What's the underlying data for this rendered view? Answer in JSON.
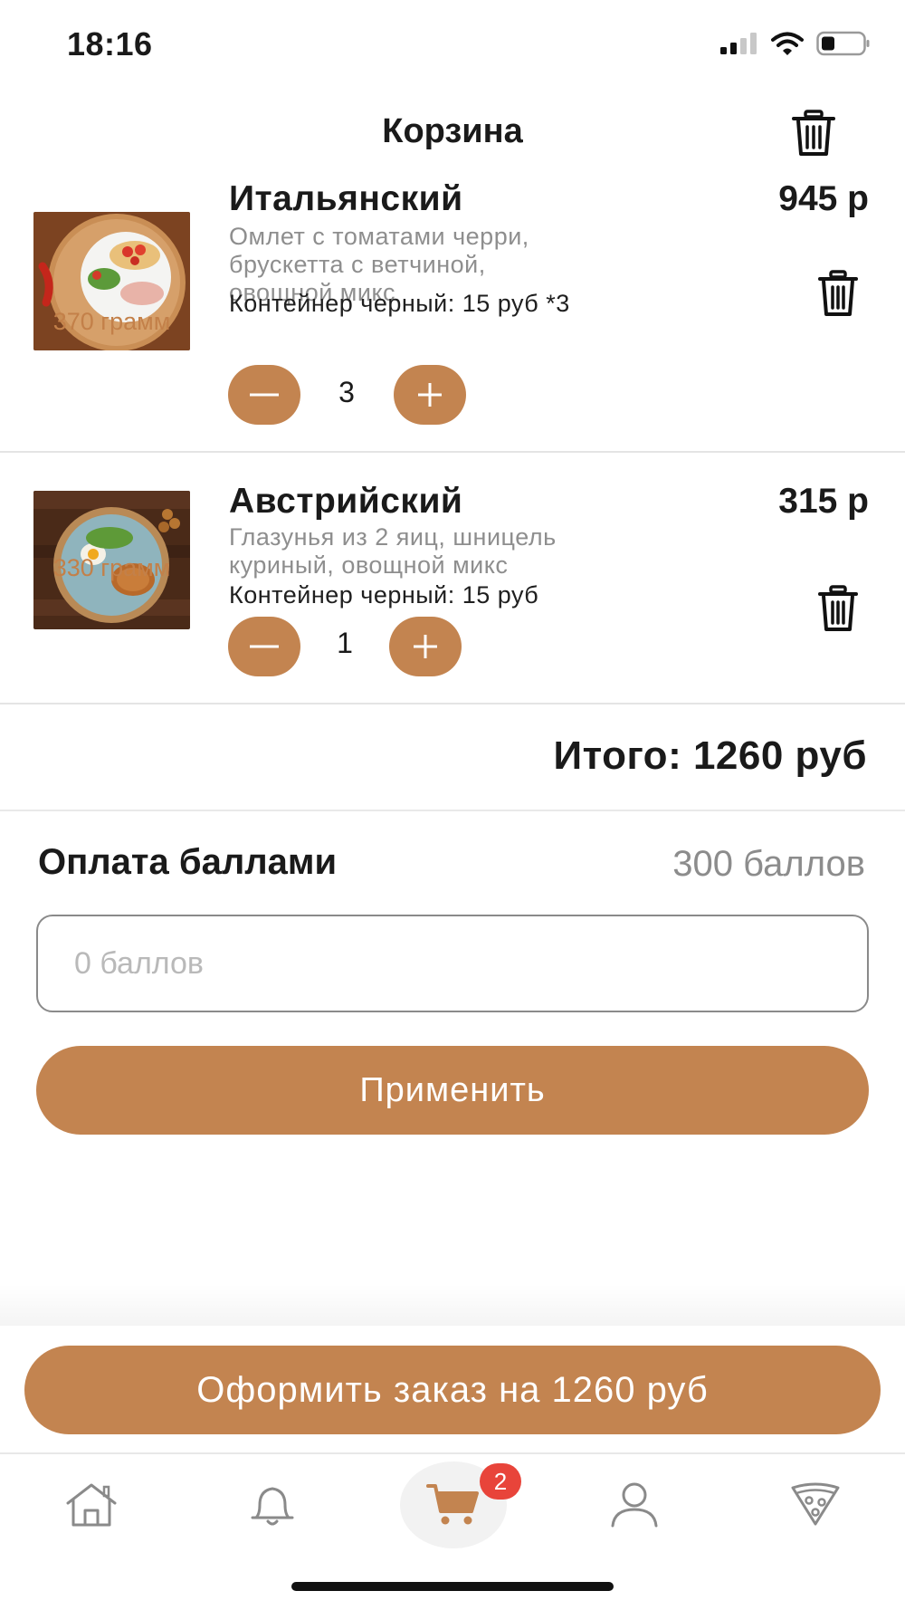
{
  "status_bar": {
    "time": "18:16"
  },
  "header": {
    "title": "Корзина",
    "clear_icon": "trash-icon"
  },
  "items": [
    {
      "name": "Итальянский",
      "description": "Омлет с томатами черри,\nбрускетта с ветчиной,\nовощной микс",
      "container": "Контейнер черный: 15 руб *3",
      "price": "945 р",
      "weight": "370 грамм",
      "quantity": "3",
      "minus_label": "—",
      "plus_label": "+"
    },
    {
      "name": "Австрийский",
      "description": "Глазунья из 2 яиц, шницель\nкуриный, овощной микс",
      "container": "Контейнер черный: 15 руб",
      "price": "315 р",
      "weight": "330 грамм",
      "quantity": "1",
      "minus_label": "—",
      "plus_label": "+"
    }
  ],
  "total": {
    "text": "Итого: 1260 руб"
  },
  "points": {
    "label": "Оплата баллами",
    "balance": "300 баллов",
    "placeholder": "0 баллов",
    "apply_label": "Применить"
  },
  "order_button": {
    "label": "Оформить заказ на 1260 руб"
  },
  "tabbar": {
    "cart_badge": "2",
    "tabs": [
      "home-icon",
      "bell-icon",
      "cart-icon",
      "profile-icon",
      "pizza-icon"
    ]
  },
  "colors": {
    "accent": "#c38450",
    "badge": "#e8443a",
    "muted": "#8e8e8e"
  }
}
